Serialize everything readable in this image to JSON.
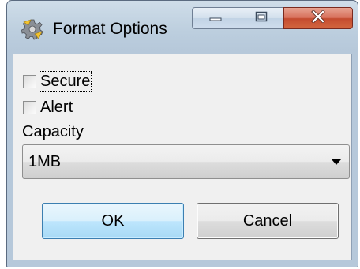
{
  "window": {
    "title": "Format Options",
    "app_icon": "gear-icon",
    "controls": {
      "minimize_icon": "minimize-icon",
      "maximize_icon": "maximize-icon",
      "close_icon": "close-icon",
      "close_color": "#c44b2f"
    }
  },
  "form": {
    "secure_label": "Secure",
    "secure_checked": false,
    "alert_label": "Alert",
    "alert_checked": false,
    "capacity_label": "Capacity",
    "capacity_value": "1MB"
  },
  "buttons": {
    "ok_label": "OK",
    "cancel_label": "Cancel"
  },
  "colors": {
    "default_button_border": "#3c7fb1",
    "dialog_background": "#f0f0f0"
  }
}
